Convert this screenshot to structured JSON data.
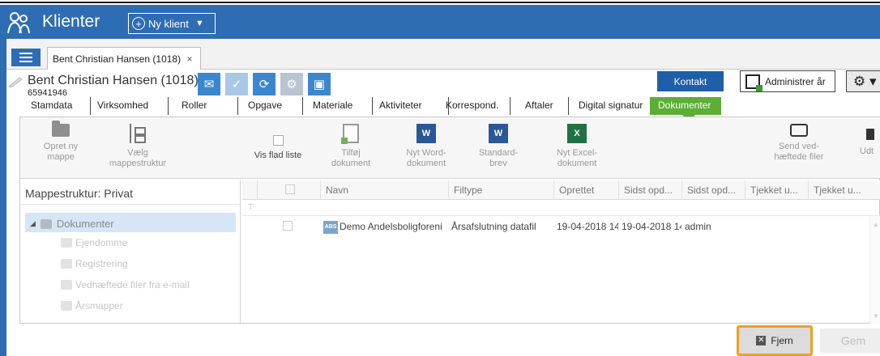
{
  "app": {
    "title": "Klienter",
    "new_client_label": "Ny klient"
  },
  "tab": {
    "label": "Bent Christian Hansen (1018)",
    "close": "×"
  },
  "client": {
    "name": "Bent Christian Hansen (1018)",
    "number": "65941946"
  },
  "header_buttons": {
    "kontakt": "Kontakt",
    "administrer": "Administrer år"
  },
  "subtabs": [
    "Stamdata",
    "Virksomhed",
    "Roller",
    "Opgave",
    "Materiale",
    "Aktiviteter",
    "Korrespond.",
    "Aftaler",
    "Digital signatur",
    "Dokumenter"
  ],
  "ribbon": {
    "opret": [
      "Opret ny",
      "mappe"
    ],
    "vaelg": [
      "Vælg",
      "mappestruktur"
    ],
    "vis_flad": "Vis flad liste",
    "tilfoej": [
      "Tilføj",
      "dokument"
    ],
    "nyt_word": [
      "Nyt Word-",
      "dokument"
    ],
    "standard": [
      "Standard-",
      "brev"
    ],
    "nyt_excel": [
      "Nyt Excel-",
      "dokument"
    ],
    "send": [
      "Send ved-",
      "hæftede filer"
    ],
    "udt": "Udt"
  },
  "tree": {
    "header": "Mappestruktur:  Privat",
    "root": "Dokumenter",
    "children": [
      "Ejendomme",
      "Registrering",
      "Vedhæftede filer fra e-mail",
      "Årsmapper"
    ]
  },
  "grid": {
    "columns": [
      "Navn",
      "Filtype",
      "Oprettet",
      "Sidst opd...",
      "Sidst opd...",
      "Tjekket u...",
      "Tjekket u..."
    ],
    "rows": [
      {
        "badge": "ABS",
        "name": "Demo Andelsboligforeni",
        "filetype": "Årsafslutning datafil",
        "created": "19-04-2018 14",
        "updated": "19-04-2018 14",
        "updated_by": "admin"
      }
    ]
  },
  "footer": {
    "fjern": "Fjern",
    "gem": "Gem"
  },
  "colors": {
    "brand": "#2e6db4",
    "active_tab": "#5cae34",
    "highlight": "#f0a020"
  }
}
